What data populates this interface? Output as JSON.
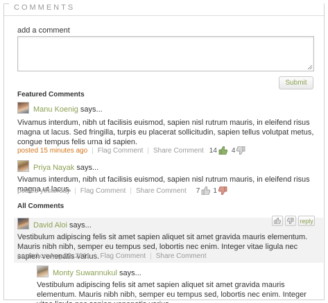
{
  "section": {
    "title": "COMMENTS"
  },
  "add_comment": {
    "label": "add a comment",
    "value": "",
    "submit_label": "Submit"
  },
  "featured": {
    "heading": "Featured Comments",
    "comments": [
      {
        "author": "Manu Koenig",
        "says": "says...",
        "text": "Vivamus interdum, nibh ut facilisis euismod, sapien nisl rutrum mauris, in eleifend risus magna ut lacus. Sed fringilla, turpis eu placerat sollicitudin, sapien tellus volutpat metus, congue tempus felis urna id sapien.",
        "timestamp": "posted 15 minutes ago",
        "flag": "Flag Comment",
        "share": "Share Comment",
        "up_count": "14",
        "down_count": "4"
      },
      {
        "author": "Priya Nayak",
        "says": "says...",
        "text": "Vivamus interdum, nibh ut facilisis euismod, sapien nisl rutrum mauris, in eleifend risus magna ut lacus.",
        "timestamp": "posted yesterday",
        "flag": "Flag Comment",
        "share": "Share Comment",
        "up_count": "7",
        "down_count": "1"
      }
    ]
  },
  "all": {
    "heading": "All Comments",
    "reply_label": "reply",
    "comments": [
      {
        "author": "David Aloi",
        "says": "says...",
        "text": "Vestibulum adipiscing felis sit amet sapien aliquet sit amet gravida mauris elementum. Mauris nibh nibh, semper eu tempus sed, lobortis nec enim. Integer vitae ligula nec sapien venenatis varius.",
        "timestamp": "posted on Aug 22, 2011",
        "flag": "Flag Comment",
        "share": "Share Comment"
      },
      {
        "author": "Monty Suwannukul",
        "says": "says...",
        "text": "Vestibulum adipiscing felis sit amet sapien aliquet sit amet gravida mauris elementum. Mauris nibh nibh, semper eu tempus sed, lobortis nec enim. Integer vitae ligula nec sapien venenatis varius."
      }
    ]
  },
  "colors": {
    "accent_green": "#8aa052",
    "timestamp_orange": "#d2741b",
    "thumb_down_red": "#c96a5a"
  },
  "icons": [
    "thumbs-up-icon",
    "thumbs-down-icon",
    "resize-grip-icon"
  ]
}
